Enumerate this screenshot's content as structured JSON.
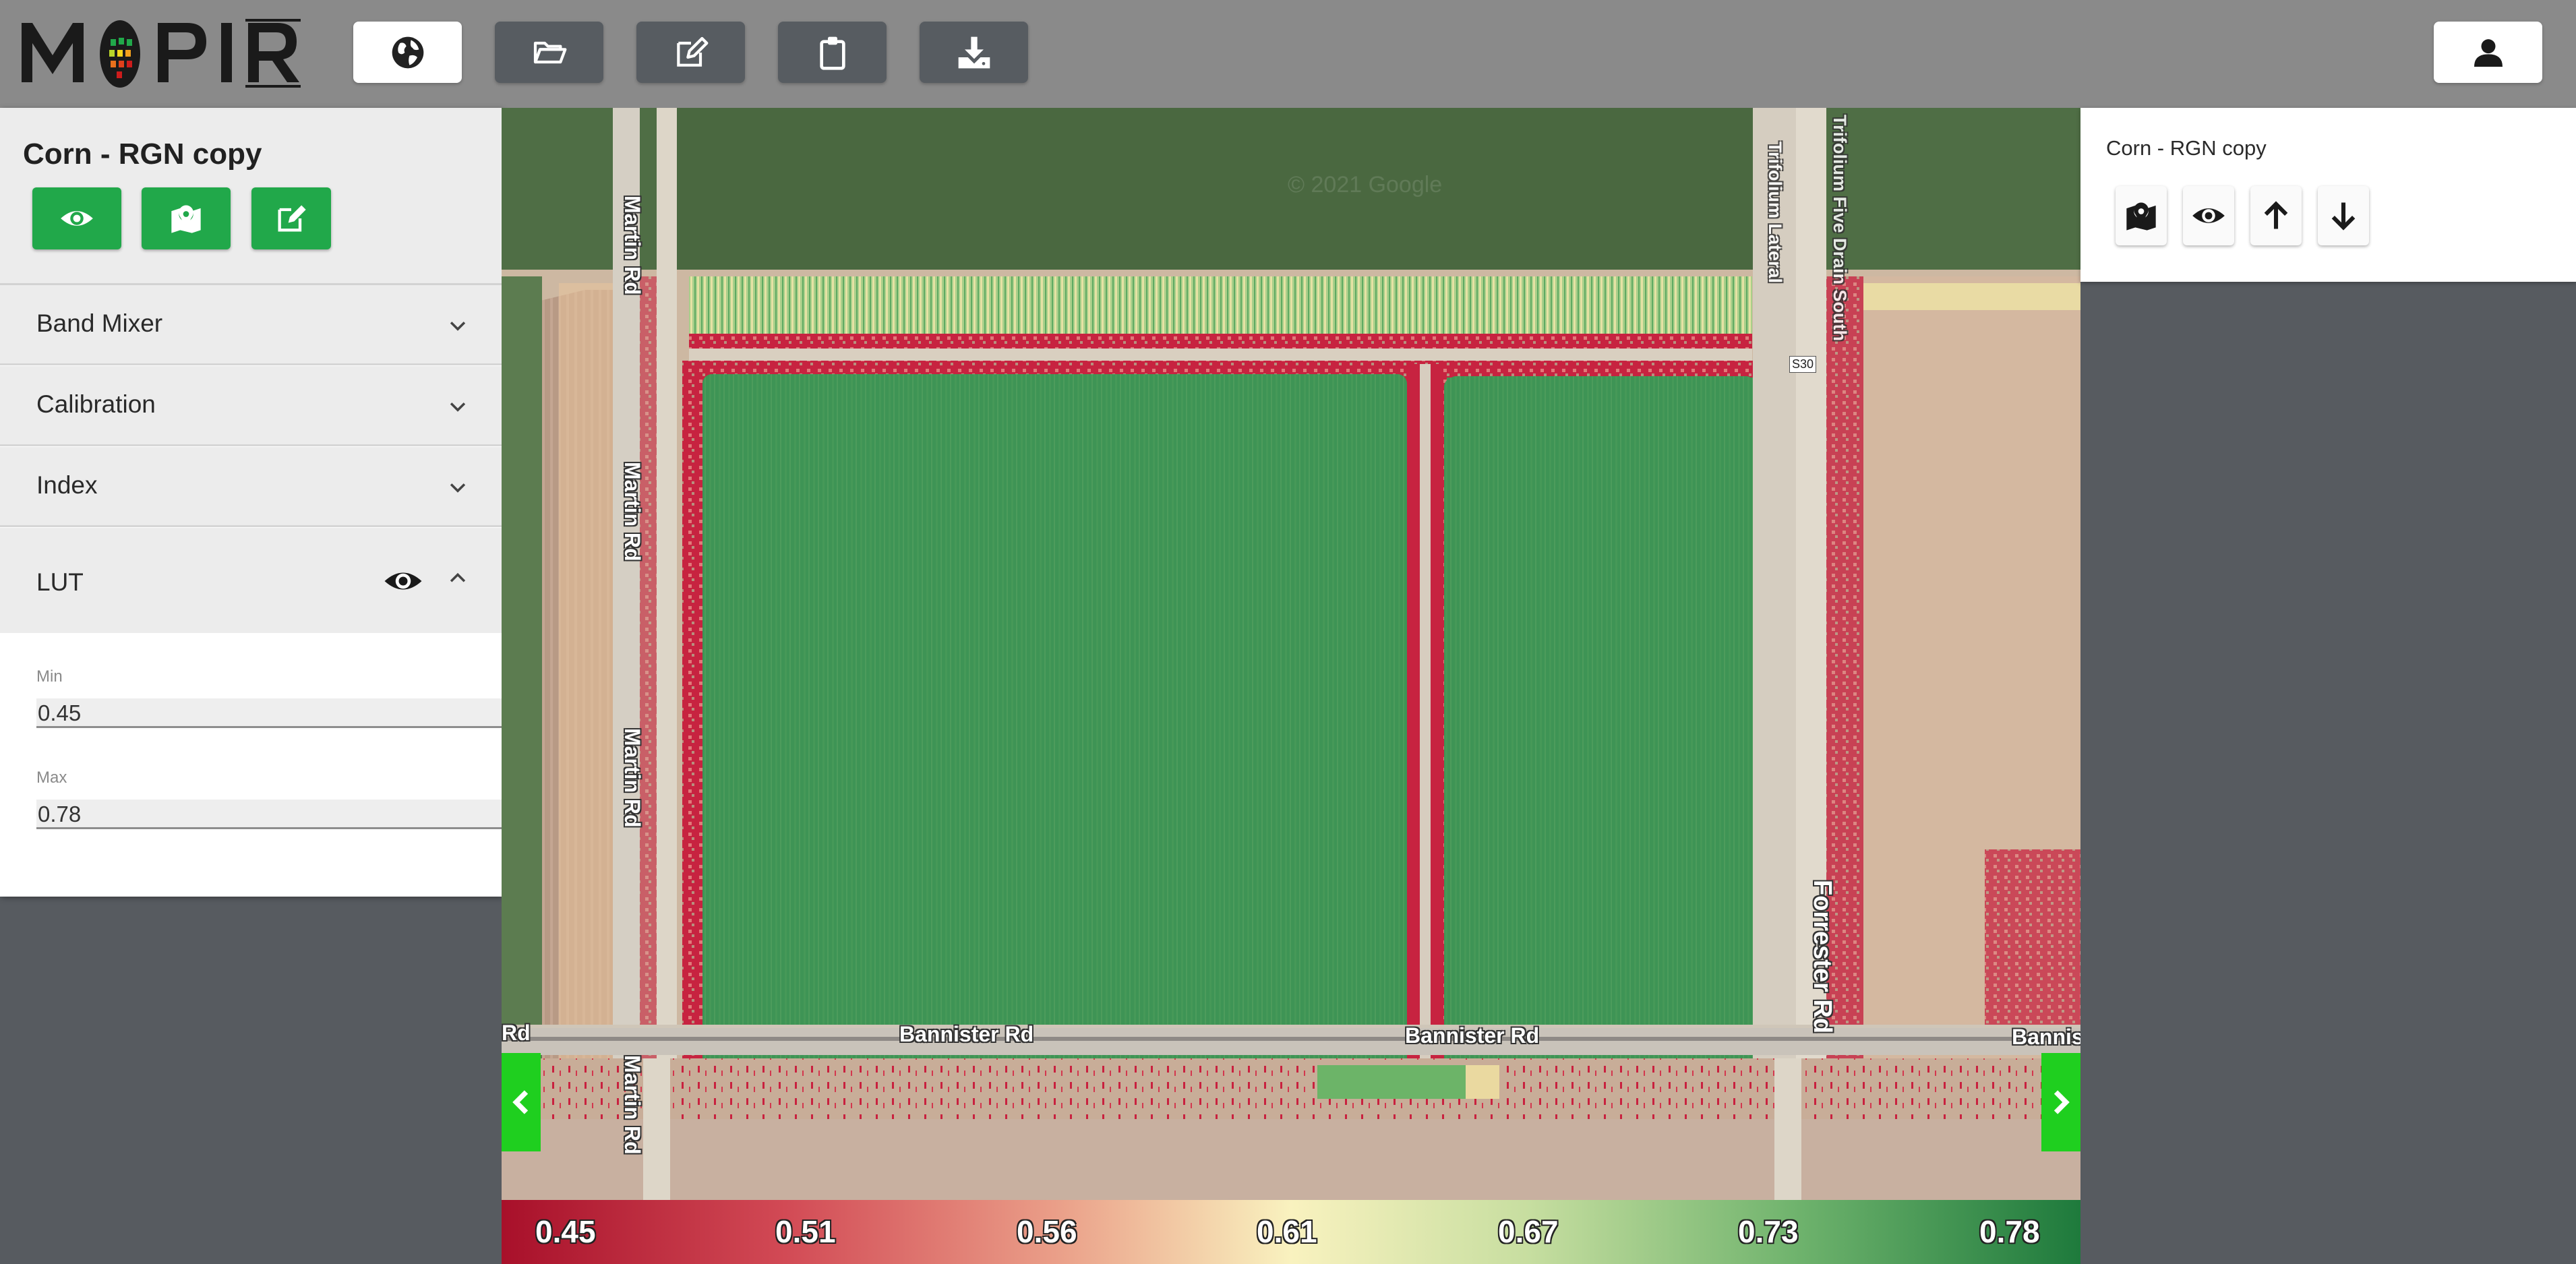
{
  "brand": {
    "logo_text": "MAPIR"
  },
  "toolbar": {
    "buttons": [
      {
        "icon": "globe-icon",
        "active": true
      },
      {
        "icon": "folder-open-icon",
        "active": false
      },
      {
        "icon": "edit-icon",
        "active": false
      },
      {
        "icon": "clipboard-icon",
        "active": false
      },
      {
        "icon": "download-icon",
        "active": false
      }
    ],
    "user_icon": "user-icon"
  },
  "left_panel": {
    "title": "Corn - RGN copy",
    "action_icons": [
      "eye-icon",
      "map-marker-icon",
      "edit-icon"
    ],
    "sections": [
      {
        "label": "Band Mixer",
        "expanded": false
      },
      {
        "label": "Calibration",
        "expanded": false
      },
      {
        "label": "Index",
        "expanded": false
      },
      {
        "label": "LUT",
        "expanded": true
      }
    ],
    "lut": {
      "min_label": "Min",
      "min_value": "0.45",
      "max_label": "Max",
      "max_value": "0.78"
    }
  },
  "map": {
    "watermark": "© 2021 Google",
    "roads": {
      "martin": "Martin Rd",
      "bannister": "Bannister Rd",
      "bannister_clipped": "Bannist",
      "rd_clipped": "Rd",
      "forrester": "Forrester Rd",
      "trifolium_lateral": "Trifolium Lateral",
      "trifolium_drain": "Trifolium Five Drain South",
      "shield": "S30"
    }
  },
  "legend": {
    "values": [
      "0.45",
      "0.51",
      "0.56",
      "0.61",
      "0.67",
      "0.73",
      "0.78"
    ],
    "colors": [
      "#a8102a",
      "#ea9e88",
      "#f9f2bf",
      "#1e7a3c"
    ]
  },
  "right_panel": {
    "layer_name": "Corn - RGN copy",
    "action_icons": [
      "map-marker-icon",
      "eye-icon",
      "arrow-up-icon",
      "arrow-down-icon"
    ]
  }
}
